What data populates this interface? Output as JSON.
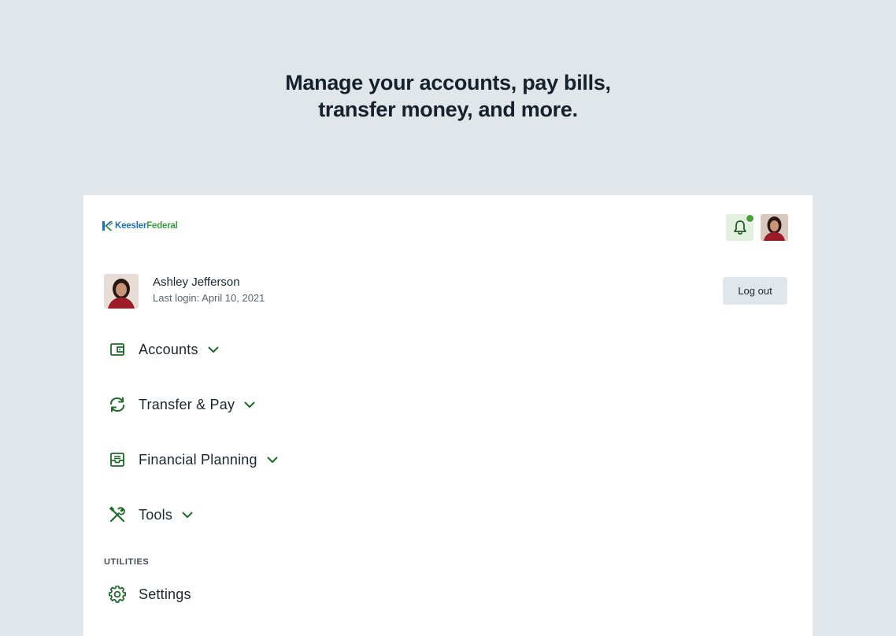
{
  "headline": {
    "line1": "Manage your accounts, pay bills,",
    "line2": "transfer money, and more."
  },
  "brand": {
    "part1": "Keesler",
    "part2": "Federal",
    "color_primary": "#1f6fb5",
    "color_accent": "#3a9a3f"
  },
  "header": {
    "notification_icon": "bell-icon",
    "notification_dot_color": "#4d9e3c"
  },
  "user": {
    "name": "Ashley Jefferson",
    "last_login": "Last login: April 10, 2021"
  },
  "logout_label": "Log out",
  "nav": {
    "items": [
      {
        "label": "Accounts",
        "icon": "wallet-icon"
      },
      {
        "label": "Transfer & Pay",
        "icon": "refresh-arrows-icon"
      },
      {
        "label": "Financial Planning",
        "icon": "tray-icon"
      },
      {
        "label": "Tools",
        "icon": "tools-icon"
      }
    ]
  },
  "utilities": {
    "title": "UTILITIES",
    "items": [
      {
        "label": "Settings",
        "icon": "gear-icon"
      }
    ]
  },
  "icon_color": "#1e6a2a"
}
